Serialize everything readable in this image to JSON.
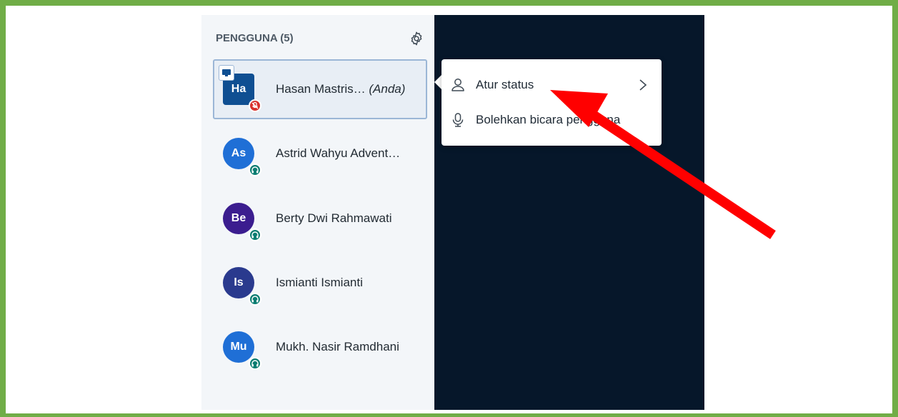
{
  "panel": {
    "title": "PENGGUNA (5)",
    "settings_icon": "gear-icon"
  },
  "users": [
    {
      "initials": "Ha",
      "name": "Hasan Mastris…",
      "suffix": "(Anda)",
      "color": "#0f4f92",
      "status_icon": "muted-mic-icon",
      "status_color": "#d9302c",
      "presenter": true,
      "selected": true
    },
    {
      "initials": "As",
      "name": "Astrid Wahyu Advent…",
      "color": "#1f6fd6",
      "status_icon": "headphones-icon",
      "status_color": "#0a7d72"
    },
    {
      "initials": "Be",
      "name": "Berty Dwi Rahmawati",
      "color": "#3b1d8f",
      "status_icon": "headphones-icon",
      "status_color": "#0a7d72"
    },
    {
      "initials": "Is",
      "name": "Ismianti Ismianti",
      "color": "#2a3a8e",
      "status_icon": "headphones-icon",
      "status_color": "#0a7d72"
    },
    {
      "initials": "Mu",
      "name": "Mukh. Nasir Ramdhani",
      "color": "#1f6fd6",
      "status_icon": "headphones-icon",
      "status_color": "#0a7d72"
    }
  ],
  "menu": {
    "items": [
      {
        "label": "Atur status",
        "icon": "user-icon",
        "has_submenu": true
      },
      {
        "label": "Bolehkan bicara pengguna",
        "icon": "microphone-icon"
      }
    ]
  },
  "colors": {
    "frame": "#70ad47",
    "panel_bg": "#f3f6f9",
    "dark_bg": "#06172a",
    "arrow": "#ff0000"
  }
}
